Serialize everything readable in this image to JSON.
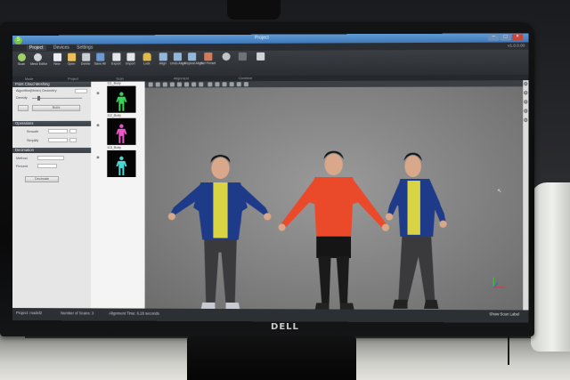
{
  "app": {
    "title": "Project",
    "version": "v1.0.0.00",
    "menu": [
      "Project",
      "Devices",
      "Settings"
    ],
    "ribbon": [
      {
        "label": "Scan",
        "icon": "scan-icon"
      },
      {
        "label": "Mesh Editor",
        "icon": "mesh-editor-icon"
      },
      {
        "label": "New",
        "icon": "new-icon"
      },
      {
        "label": "Open",
        "icon": "open-icon"
      },
      {
        "label": "Delete",
        "icon": "delete-icon"
      },
      {
        "label": "Save All",
        "icon": "save-icon"
      },
      {
        "label": "Export",
        "icon": "export-icon"
      },
      {
        "label": "Import",
        "icon": "import-icon"
      },
      {
        "label": "Lock",
        "icon": "lock-icon"
      },
      {
        "label": "Align",
        "icon": "align-icon"
      },
      {
        "label": "Undo Align",
        "icon": "undo-align-icon"
      },
      {
        "label": "Repeat Align",
        "icon": "repeat-align-icon"
      },
      {
        "label": "Set Preset",
        "icon": "preset-icon"
      }
    ],
    "groups": [
      "Mode",
      "Project",
      "Scan",
      "Alignment",
      "Combine"
    ]
  },
  "left_panel": {
    "header1": "Point Cloud Meshing",
    "row1": "Algorithm(Mesh) Geometry",
    "row2": "Density",
    "button1": "Build",
    "header2": "Operations",
    "row3": "Smooth",
    "row4": "Simplify",
    "header3": "Decimation",
    "row5": "Method",
    "row6": "Percent",
    "button2": "Decimate"
  },
  "scans": [
    {
      "label": "111_Body",
      "color": "#3dd05a"
    },
    {
      "label": "112_Body",
      "color": "#e858c8"
    },
    {
      "label": "113_Body",
      "color": "#4fd6d2"
    }
  ],
  "status": {
    "project": "Project: model2",
    "scans": "Number of Scans: 3",
    "time": "Alignment Time: 6.28 seconds",
    "right": "Show Scan Label"
  },
  "brand": "DELL",
  "colors": {
    "title_blue": "#4a86c6",
    "accent_green": "#7cc34a"
  }
}
